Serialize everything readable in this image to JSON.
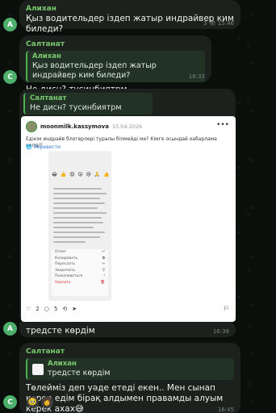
{
  "messages": [
    {
      "sender": "Алихан",
      "text": "Қыз водительдер іздеп жатыр индрайвер ким биледи?",
      "views": "3",
      "time": "15:46",
      "avatar_letter": "А"
    },
    {
      "sender": "Салтанат",
      "quote_name": "Алихан",
      "quote_text": "Қыз водительдер іздеп жатыр индрайвер ким биледи?",
      "text": "Не дисн? тусинбиятрм",
      "time": "16:33",
      "avatar_letter": "С"
    },
    {
      "quote_name": "Салтанат",
      "quote_text": "Не дисн? тусинбиятрм"
    },
    {
      "text": "тредсте көрдім",
      "time": "16:39",
      "avatar_letter": "А"
    },
    {
      "sender": "Салтанат",
      "quote_name": "Алихан",
      "quote_text": "тредсте көрдім",
      "text": "Төлейміз деп уәде етеді екен.. Мен сынап көрер едім бірақ алдымен правамды алуым керек ахах😅",
      "time": "16:45",
      "avatar_letter": "С",
      "reactions": [
        "🥹",
        "👩"
      ]
    }
  ],
  "post": {
    "username": "moonmilk.kassymova",
    "date": "15.04.2026",
    "caption": "Едікім индрайв блогерлері туралы білмейді ме? Кімге осындай хабарлама келді?",
    "translate_label": "Перевести",
    "likes": "2",
    "comments": "5",
    "emojis": "😂 👍 😍 😮 😢 🙏 👍",
    "menu": [
      "Ответ",
      "Копировать",
      "Переслать",
      "Закрепить",
      "Пожаловаться",
      "Удалить"
    ],
    "more_icon": "more-dots-icon"
  },
  "colors": {
    "accent": "#4caf50",
    "bubble": "#1d211e",
    "background": "#0b0f0c"
  }
}
